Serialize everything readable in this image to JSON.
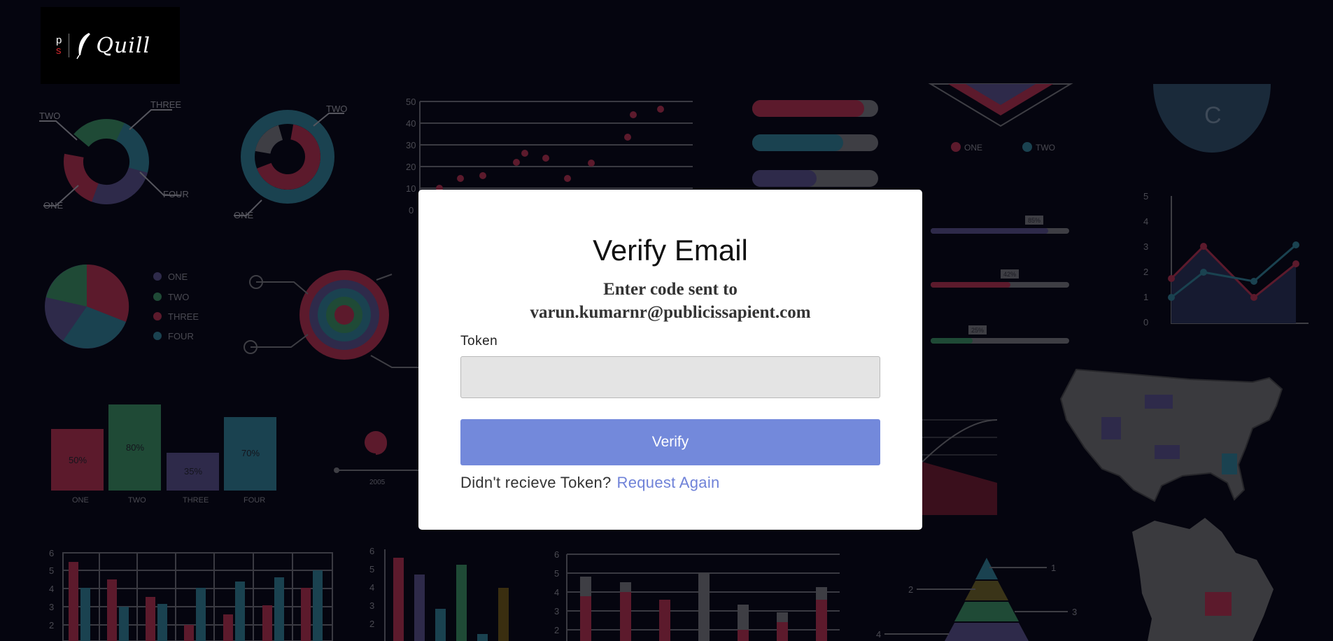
{
  "logo": {
    "letter_p": "p",
    "letter_s": "s",
    "wordmark": "Quill"
  },
  "modal": {
    "title": "Verify Email",
    "subtitle_line1": "Enter code sent to",
    "subtitle_line2": "varun.kumarnr@publicissapient.com",
    "token_label": "Token",
    "token_value": "",
    "token_placeholder": "",
    "verify_label": "Verify",
    "resend_prompt": "Didn't recieve Token?",
    "resend_link": "Request Again"
  },
  "background": {
    "donut1_labels": [
      "TWO",
      "THREE",
      "ONE",
      "FOUR"
    ],
    "donut2_labels": [
      "TWO",
      "ONE"
    ],
    "scatter_yticks": [
      "50",
      "40",
      "30",
      "20",
      "10",
      "0"
    ],
    "pie_legend": [
      "ONE",
      "TWO",
      "THREE",
      "FOUR"
    ],
    "bars": [
      {
        "cat": "ONE",
        "pct": "50%",
        "value": 50
      },
      {
        "cat": "TWO",
        "pct": "80%",
        "value": 80
      },
      {
        "cat": "THREE",
        "pct": "35%",
        "value": 35
      },
      {
        "cat": "FOUR",
        "pct": "70%",
        "value": 70
      }
    ],
    "timeline_year": "2005",
    "triangle_legend": [
      "ONE",
      "TWO"
    ],
    "gauge_letter": "C",
    "slider_pcts": [
      "85%",
      "42%",
      "25%"
    ],
    "line_yticks": [
      "5",
      "4",
      "3",
      "2",
      "1",
      "0"
    ],
    "bottom_yticks": [
      "6",
      "5",
      "4",
      "3",
      "2"
    ],
    "pyramid_labels": [
      "1",
      "2",
      "3",
      "4"
    ],
    "colors": {
      "red": "#5c1a2c",
      "green": "#1f4a36",
      "teal": "#1a4250",
      "purple": "#2e2a4a",
      "gray": "#3e3e44",
      "line": "#56565e"
    }
  }
}
